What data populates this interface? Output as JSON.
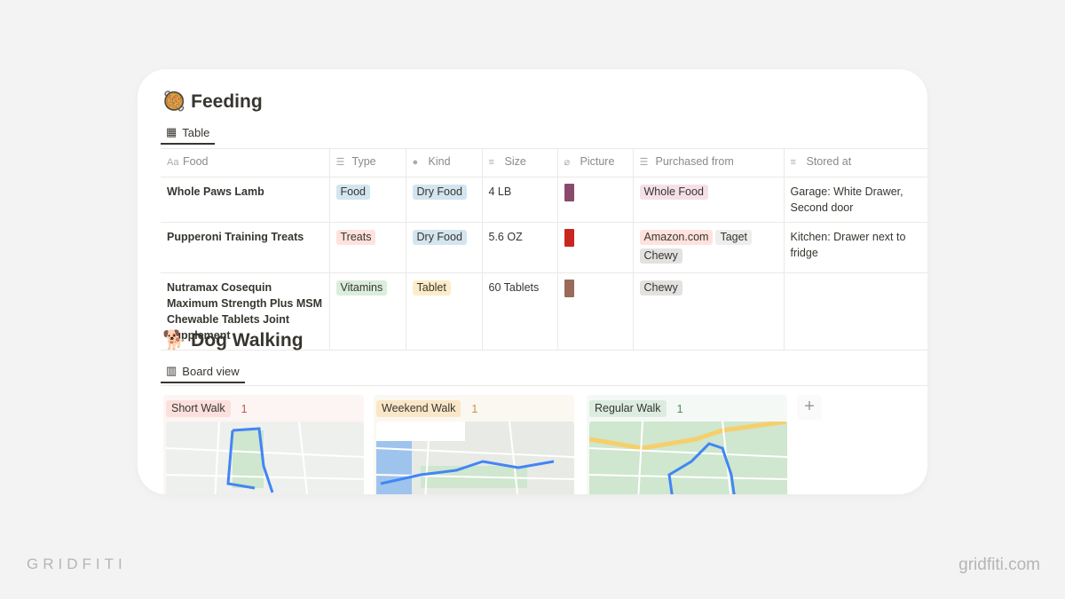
{
  "feeding": {
    "emoji": "🥘",
    "title": "Feeding",
    "view_tab": "Table",
    "columns": [
      {
        "icon": "Aa",
        "label": "Food"
      },
      {
        "icon": "☰",
        "label": "Type"
      },
      {
        "icon": "●",
        "label": "Kind"
      },
      {
        "icon": "≡",
        "label": "Size"
      },
      {
        "icon": "⌀",
        "label": "Picture"
      },
      {
        "icon": "☰",
        "label": "Purchased from"
      },
      {
        "icon": "≡",
        "label": "Stored at"
      }
    ],
    "rows": [
      {
        "food": "Whole Paws Lamb",
        "type": "Food",
        "kind": "Dry Food",
        "size": "4 LB",
        "picture_color": "#8a4b6a",
        "purchased": [
          "Whole Food"
        ],
        "stored": "Garage: White Drawer, Second door"
      },
      {
        "food": "Pupperoni Training Treats",
        "type": "Treats",
        "kind": "Dry Food",
        "size": "5.6 OZ",
        "picture_color": "#c8261e",
        "purchased": [
          "Amazon.com",
          "Taget",
          "Chewy"
        ],
        "stored": "Kitchen: Drawer next to fridge"
      },
      {
        "food": "Nutramax Cosequin Maximum Strength Plus MSM Chewable Tablets Joint Supplement",
        "type": "Vitamins",
        "kind": "Tablet",
        "size": "60 Tablets",
        "picture_color": "#9a6a5a",
        "purchased": [
          "Chewy"
        ],
        "stored": ""
      }
    ]
  },
  "walking": {
    "emoji": "🐕",
    "title": "Dog Walking",
    "view_tab": "Board view",
    "groups": [
      {
        "label": "Short Walk",
        "count": "1",
        "bg": "#fdf5f3",
        "tag": "#fbe0dd",
        "color": "#c4554d"
      },
      {
        "label": "Weekend Walk",
        "count": "1",
        "bg": "#fbf8f1",
        "tag": "#fae7c8",
        "color": "#c29343"
      },
      {
        "label": "Regular Walk",
        "count": "1",
        "bg": "#f5f9f5",
        "tag": "#dcecdf",
        "color": "#4f8a5b"
      }
    ],
    "add_label": "+"
  },
  "watermark": {
    "left": "GRIDFITI",
    "right": "gridfiti.com"
  }
}
